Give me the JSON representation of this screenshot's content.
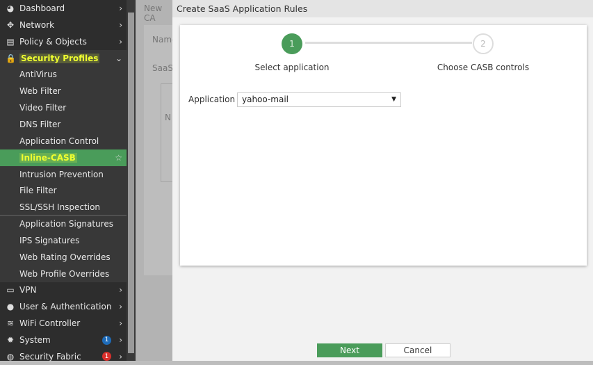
{
  "sidebar": {
    "items": [
      {
        "label": "Dashboard",
        "icon": "dashboard-icon"
      },
      {
        "label": "Network",
        "icon": "network-icon"
      },
      {
        "label": "Policy & Objects",
        "icon": "policy-icon"
      },
      {
        "label": "Security Profiles",
        "icon": "lock-icon"
      },
      {
        "label": "AntiVirus"
      },
      {
        "label": "Web Filter"
      },
      {
        "label": "Video Filter"
      },
      {
        "label": "DNS Filter"
      },
      {
        "label": "Application Control"
      },
      {
        "label": "Inline-CASB"
      },
      {
        "label": "Intrusion Prevention"
      },
      {
        "label": "File Filter"
      },
      {
        "label": "SSL/SSH Inspection"
      },
      {
        "label": "Application Signatures"
      },
      {
        "label": "IPS Signatures"
      },
      {
        "label": "Web Rating Overrides"
      },
      {
        "label": "Web Profile Overrides"
      },
      {
        "label": "VPN",
        "icon": "laptop-icon"
      },
      {
        "label": "User & Authentication",
        "icon": "user-icon"
      },
      {
        "label": "WiFi Controller",
        "icon": "wifi-icon"
      },
      {
        "label": "System",
        "icon": "gear-icon",
        "badge": "1"
      },
      {
        "label": "Security Fabric",
        "icon": "fabric-icon",
        "badge": "1"
      }
    ]
  },
  "background": {
    "title": "New CA",
    "name_label": "Name",
    "saas_label": "SaaS",
    "col": "N"
  },
  "dialog": {
    "title": "Create SaaS Application Rules",
    "steps": [
      {
        "num": "1",
        "label": "Select application"
      },
      {
        "num": "2",
        "label": "Choose CASB controls"
      }
    ],
    "application_label": "Application",
    "application_value": "yahoo-mail",
    "next_label": "Next",
    "cancel_label": "Cancel"
  },
  "colors": {
    "accent": "#4a9c5a",
    "badge_blue": "#1e6bb8",
    "badge_red": "#d9302c"
  }
}
